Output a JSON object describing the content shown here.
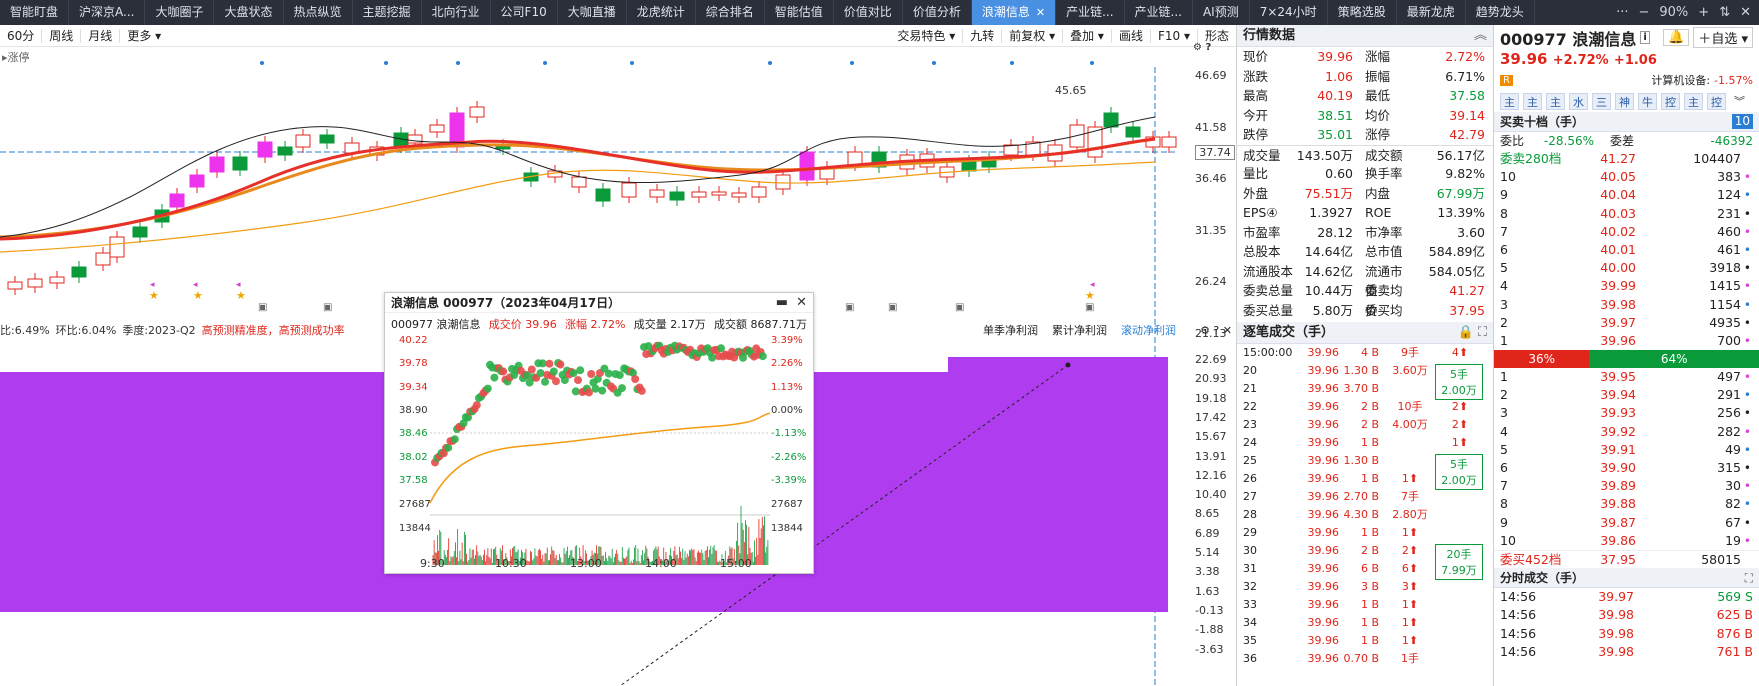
{
  "nav": {
    "tabs": [
      "智能盯盘",
      "沪深京A...",
      "大咖圈子",
      "大盘状态",
      "热点纵览",
      "主题挖掘",
      "北向行业",
      "公司F10",
      "大咖直播",
      "龙虎统计",
      "综合排名",
      "智能估值",
      "价值对比",
      "价值分析",
      "浪潮信息",
      "产业链...",
      "产业链...",
      "AI预测",
      "7×24小时",
      "策略选股",
      "最新龙虎",
      "趋势龙头"
    ],
    "active_index": 14,
    "zoom": "90%",
    "win_controls": [
      "···",
      "−",
      "+",
      "⇅",
      "✕"
    ]
  },
  "toolbar": {
    "left": [
      "60分",
      "周线",
      "月线",
      "更多"
    ],
    "right": [
      "交易特色",
      "九转",
      "前复权",
      "叠加",
      "画线",
      "F10",
      "形态"
    ]
  },
  "main_chart": {
    "limit_label": "涨停",
    "y_labels": [
      "46.69",
      "41.58",
      "36.46",
      "31.35",
      "26.24",
      "21.13"
    ],
    "current_price_tag": "37.74",
    "high_label": "45.65",
    "sub_legend": {
      "a": "6.49%",
      "b_label": "环比:",
      "b": "6.04%",
      "season": "季度:2023-Q2",
      "note": "高预测精准度，高预测成功率"
    },
    "sub_tabs": [
      "单季净利润",
      "累计净利润",
      "滚动净利润"
    ],
    "sub_y_labels": [
      "22.69",
      "20.93",
      "19.18",
      "17.42",
      "15.67",
      "13.91",
      "12.16",
      "10.40",
      "8.65",
      "6.89",
      "5.14",
      "3.38",
      "1.63",
      "-0.13",
      "-1.88",
      "-3.63"
    ]
  },
  "popup": {
    "title": "浪潮信息 000977（2023年04月17日）",
    "name_code": "000977 浪潮信息",
    "price_label": "成交价",
    "price": "39.96",
    "chg_label": "涨幅",
    "chg": "2.72%",
    "vol_label": "成交量",
    "vol": "2.17万",
    "amt_label": "成交额",
    "amt": "8687.71万",
    "left_axis": [
      "40.22",
      "39.78",
      "39.34",
      "38.90",
      "38.46",
      "38.02",
      "37.58"
    ],
    "right_axis": [
      "3.39%",
      "2.26%",
      "1.13%",
      "0.00%",
      "-1.13%",
      "-2.26%",
      "-3.39%"
    ],
    "vol_axis": [
      "27687",
      "13844"
    ],
    "times": [
      "9:30",
      "10:30",
      "13:00",
      "14:00",
      "15:00"
    ]
  },
  "quote": {
    "title": "行情数据",
    "rows": [
      [
        "现价",
        "39.96",
        "red",
        "涨幅",
        "2.72%",
        "red"
      ],
      [
        "涨跌",
        "1.06",
        "red",
        "振幅",
        "6.71%",
        "dark"
      ],
      [
        "最高",
        "40.19",
        "red",
        "最低",
        "37.58",
        "green"
      ],
      [
        "今开",
        "38.51",
        "green",
        "均价",
        "39.14",
        "red"
      ],
      [
        "跌停",
        "35.01",
        "green",
        "涨停",
        "42.79",
        "red"
      ],
      [
        "成交量",
        "143.50万",
        "dark",
        "成交额",
        "56.17亿",
        "dark"
      ],
      [
        "量比",
        "0.60",
        "dark",
        "换手率",
        "9.82%",
        "dark"
      ],
      [
        "外盘",
        "75.51万",
        "red",
        "内盘",
        "67.99万",
        "green"
      ],
      [
        "EPS④",
        "1.3927",
        "dark",
        "ROE",
        "13.39%",
        "dark"
      ],
      [
        "市盈率",
        "28.12",
        "dark",
        "市净率",
        "3.60",
        "dark"
      ],
      [
        "总股本",
        "14.64亿",
        "dark",
        "总市值",
        "584.89亿",
        "dark"
      ],
      [
        "流通股本",
        "14.62亿",
        "dark",
        "流通市值",
        "584.05亿",
        "dark"
      ],
      [
        "委卖总量",
        "10.44万",
        "dark",
        "委卖均价",
        "41.27",
        "red"
      ],
      [
        "委买总量",
        "5.80万",
        "dark",
        "委买均价",
        "37.95",
        "red"
      ]
    ]
  },
  "ticks": {
    "title": "逐笔成交（手）",
    "rows": [
      [
        "15:00:00",
        "39.96",
        "4 B",
        "9手",
        "4⬆"
      ],
      [
        "20",
        "39.96",
        "1.30 B",
        "3.60万",
        ""
      ],
      [
        "21",
        "39.96",
        "3.70 B",
        "",
        "2⬆"
      ],
      [
        "22",
        "39.96",
        "2 B",
        "10手",
        "2⬆"
      ],
      [
        "23",
        "39.96",
        "2 B",
        "4.00万",
        "2⬆"
      ],
      [
        "24",
        "39.96",
        "1 B",
        "",
        "1⬆"
      ],
      [
        "25",
        "39.96",
        "1.30 B",
        "",
        ""
      ],
      [
        "26",
        "39.96",
        "1 B",
        "1⬆",
        ""
      ],
      [
        "27",
        "39.96",
        "2.70 B",
        "7手",
        ""
      ],
      [
        "28",
        "39.96",
        "4.30 B",
        "2.80万",
        ""
      ],
      [
        "29",
        "39.96",
        "1 B",
        "1⬆",
        ""
      ],
      [
        "30",
        "39.96",
        "2 B",
        "2⬆",
        ""
      ],
      [
        "31",
        "39.96",
        "6 B",
        "6⬆",
        ""
      ],
      [
        "32",
        "39.96",
        "3 B",
        "3⬆",
        ""
      ],
      [
        "33",
        "39.96",
        "1 B",
        "1⬆",
        ""
      ],
      [
        "34",
        "39.96",
        "1 B",
        "1⬆",
        ""
      ],
      [
        "35",
        "39.96",
        "1 B",
        "1⬆",
        ""
      ],
      [
        "36",
        "39.96",
        "0.70 B",
        "1手",
        ""
      ]
    ],
    "group_boxes": [
      [
        "5手",
        "2.00万"
      ],
      [
        "5手",
        "2.00万"
      ],
      [
        "20手",
        "7.99万"
      ]
    ]
  },
  "stock": {
    "code_name": "000977 浪潮信息",
    "price": "39.96",
    "chg_pct": "+2.72%",
    "chg": "+1.06",
    "industry": "计算机设备:",
    "industry_pct": "-1.57%",
    "fav": "自选",
    "tag": "R",
    "buttons": [
      "主",
      "主",
      "主",
      "水",
      "三",
      "神",
      "牛",
      "控",
      "主",
      "控"
    ]
  },
  "orderbook": {
    "title": "买卖十档（手）",
    "badge": "10",
    "weibi_label": "委比",
    "weibi": "-28.56%",
    "weicha_label": "委差",
    "weicha": "-46392",
    "sell_header": [
      "委卖280档",
      "41.27",
      "104407"
    ],
    "sell": [
      [
        "10",
        "40.05",
        "383"
      ],
      [
        "9",
        "40.04",
        "124"
      ],
      [
        "8",
        "40.03",
        "231"
      ],
      [
        "7",
        "40.02",
        "460"
      ],
      [
        "6",
        "40.01",
        "461"
      ],
      [
        "5",
        "40.00",
        "3918"
      ],
      [
        "4",
        "39.99",
        "1415"
      ],
      [
        "3",
        "39.98",
        "1154"
      ],
      [
        "2",
        "39.97",
        "4935"
      ],
      [
        "1",
        "39.96",
        "700"
      ]
    ],
    "ratio_sell": "36%",
    "ratio_buy": "64%",
    "buy": [
      [
        "1",
        "39.95",
        "497"
      ],
      [
        "2",
        "39.94",
        "291"
      ],
      [
        "3",
        "39.93",
        "256"
      ],
      [
        "4",
        "39.92",
        "282"
      ],
      [
        "5",
        "39.91",
        "49"
      ],
      [
        "6",
        "39.90",
        "315"
      ],
      [
        "7",
        "39.89",
        "30"
      ],
      [
        "8",
        "39.88",
        "82"
      ],
      [
        "9",
        "39.87",
        "67"
      ],
      [
        "10",
        "39.86",
        "19"
      ]
    ],
    "buy_footer": [
      "委买452档",
      "37.95",
      "58015"
    ]
  },
  "time_sales": {
    "title": "分时成交（手）",
    "rows": [
      [
        "14:56",
        "39.97",
        "569 S"
      ],
      [
        "14:56",
        "39.98",
        "625 B"
      ],
      [
        "14:56",
        "39.98",
        "876 B"
      ],
      [
        "14:56",
        "39.98",
        "761 B"
      ]
    ]
  }
}
